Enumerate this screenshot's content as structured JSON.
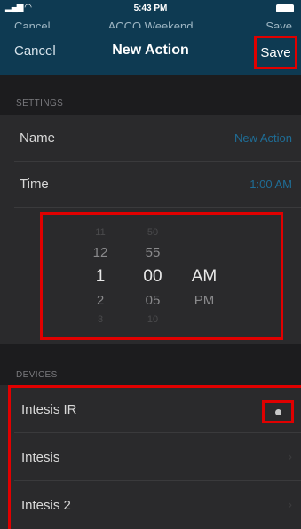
{
  "status_bar": {
    "time": "5:43 PM",
    "signal_icon": "signal-wifi-icon",
    "battery_icon": "battery-icon"
  },
  "behind_nav": {
    "left": "Cancel",
    "center": "ACCO Weekend",
    "right": "Save"
  },
  "nav": {
    "cancel_label": "Cancel",
    "title": "New Action",
    "save_label": "Save"
  },
  "settings": {
    "header": "SETTINGS",
    "name": {
      "label": "Name",
      "value": "New Action"
    },
    "time": {
      "label": "Time",
      "value": "1:00 AM"
    }
  },
  "picker": {
    "hours": [
      "11",
      "12",
      "1",
      "2",
      "3"
    ],
    "minutes": [
      "50",
      "55",
      "00",
      "05",
      "10"
    ],
    "periods": [
      "AM",
      "PM"
    ],
    "selected": {
      "hour": "1",
      "minute": "00",
      "period": "AM"
    }
  },
  "devices": {
    "header": "DEVICES",
    "items": [
      {
        "label": "Intesis IR",
        "indicator": "status-dot-icon"
      },
      {
        "label": "Intesis",
        "indicator": "chevron-right-icon"
      },
      {
        "label": "Intesis 2",
        "indicator": "chevron-right-icon"
      }
    ]
  },
  "colors": {
    "nav_bar": "#0e3a52",
    "background": "#1c1c1e",
    "row": "#2a2a2c",
    "value_text": "#1f6d96",
    "highlight": "#e00000"
  }
}
